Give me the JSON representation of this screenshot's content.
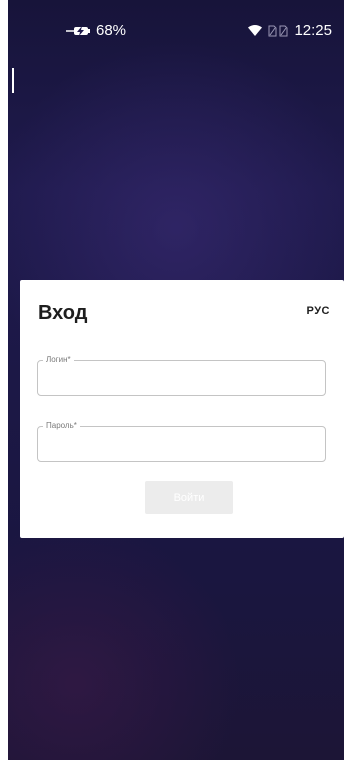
{
  "status_bar": {
    "battery_percent": "68%",
    "time": "12:25",
    "icons": [
      "battery-charging-icon",
      "wifi-icon",
      "sim-icon",
      "sim-icon"
    ]
  },
  "login_form": {
    "title": "Вход",
    "language": "РУС",
    "login_label": "Логин*",
    "login_value": "",
    "password_label": "Пароль*",
    "password_value": "",
    "submit_label": "Войти"
  },
  "colors": {
    "background": "#1e1a4a",
    "card": "#ffffff",
    "button_disabled": "#ececec"
  }
}
